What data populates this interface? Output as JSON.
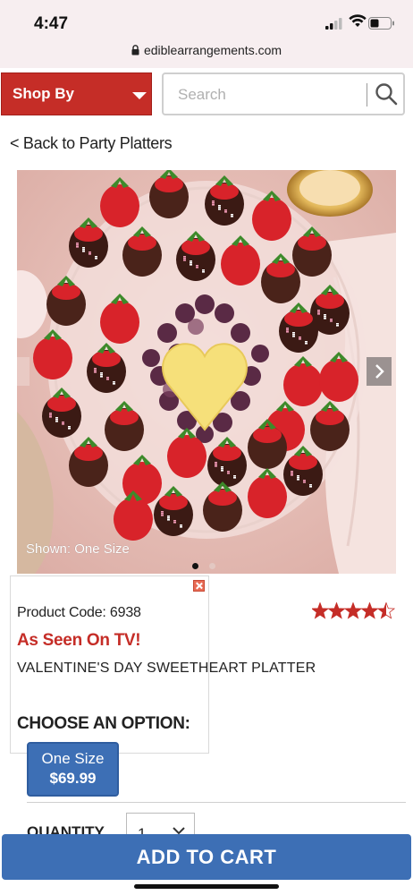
{
  "status_bar": {
    "time": "4:47",
    "url": "ediblearrangements.com",
    "icons": [
      "cellular-signal-icon",
      "wifi-icon",
      "battery-icon",
      "lock-icon"
    ]
  },
  "header": {
    "shop_by_label": "Shop By",
    "search_placeholder": "Search",
    "accent_color": "#c52d27"
  },
  "breadcrumb": {
    "back_label": "< Back to Party Platters"
  },
  "gallery": {
    "caption": "Shown: One Size",
    "slide_count": 2,
    "active_slide": 1
  },
  "product": {
    "code_label": "Product Code: 6938",
    "badge": "As Seen On TV!",
    "name": "VALENTINE'S DAY SWEETHEART PLATTER",
    "rating": 4.5,
    "rating_max": 5
  },
  "options": {
    "heading": "CHOOSE AN OPTION:",
    "selected": {
      "name": "One Size",
      "price": "$69.99"
    }
  },
  "quantity": {
    "label": "QUANTITY",
    "value": "1"
  },
  "cart": {
    "button_label": "ADD TO CART",
    "button_color": "#3d6fb5"
  }
}
